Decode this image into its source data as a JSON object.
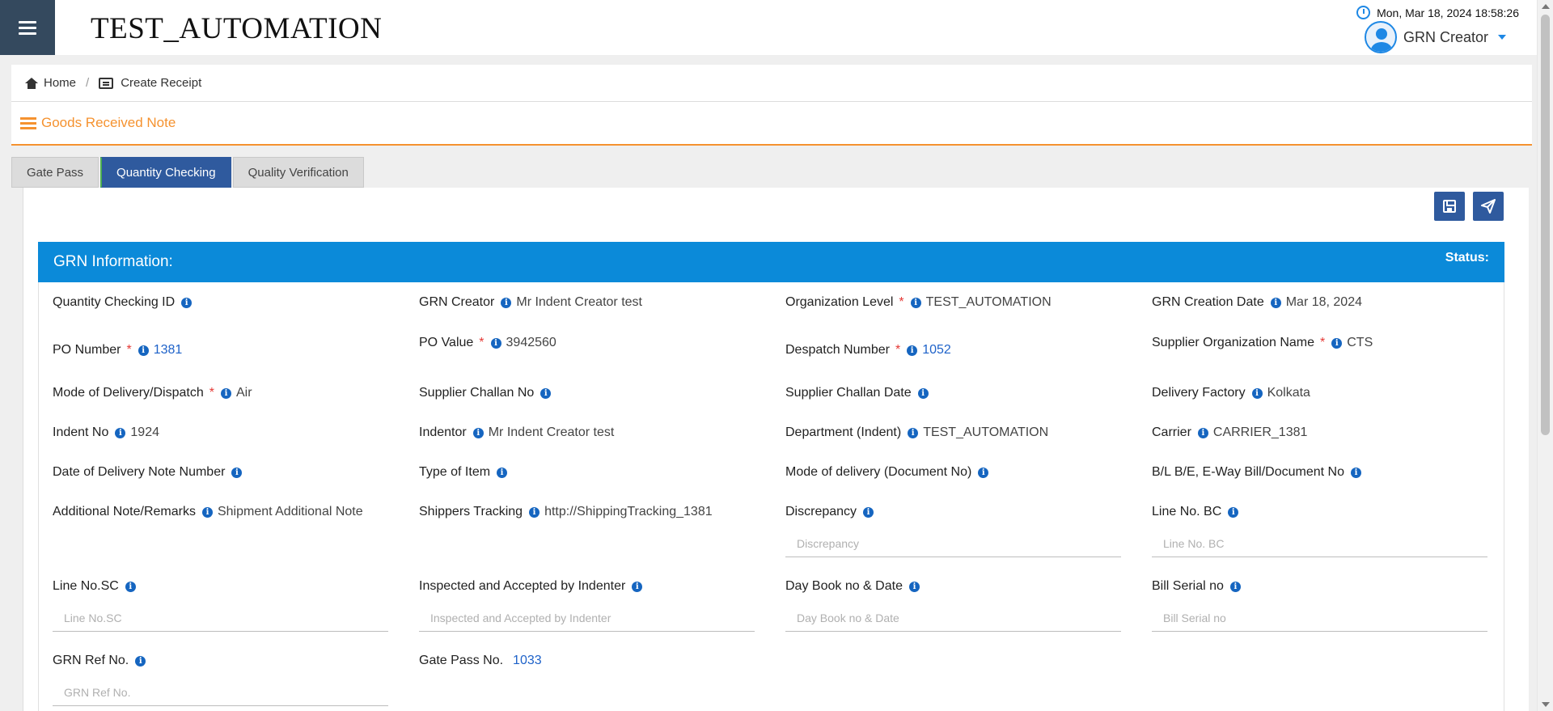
{
  "app": {
    "title": "TEST_AUTOMATION",
    "datetime": "Mon, Mar 18, 2024 18:58:26",
    "user_role": "GRN Creator"
  },
  "breadcrumb": {
    "home": "Home",
    "current": "Create Receipt"
  },
  "panel": {
    "heading": "Goods Received Note"
  },
  "tabs": [
    {
      "label": "Gate Pass"
    },
    {
      "label": "Quantity Checking"
    },
    {
      "label": "Quality Verification"
    }
  ],
  "active_tab": "Quantity Checking",
  "section": {
    "title": "GRN Information:",
    "status_label": "Status:"
  },
  "fields": {
    "quantity_checking_id": {
      "label": "Quantity Checking ID",
      "value": ""
    },
    "grn_creator": {
      "label": "GRN Creator",
      "value": "Mr Indent Creator test"
    },
    "organization_level": {
      "label": "Organization Level",
      "value": "TEST_AUTOMATION"
    },
    "grn_creation_date": {
      "label": "GRN Creation Date",
      "value": "Mar 18, 2024"
    },
    "po_number": {
      "label": "PO Number",
      "value": "1381"
    },
    "po_value": {
      "label": "PO Value",
      "value": "3942560"
    },
    "despatch_number": {
      "label": "Despatch Number",
      "value": "1052"
    },
    "supplier_org_name": {
      "label": "Supplier Organization Name",
      "value": "CTS"
    },
    "mode_of_delivery": {
      "label": "Mode of Delivery/Dispatch",
      "value": "Air"
    },
    "supplier_challan_no": {
      "label": "Supplier Challan No",
      "value": ""
    },
    "supplier_challan_date": {
      "label": "Supplier Challan Date",
      "value": ""
    },
    "delivery_factory": {
      "label": "Delivery Factory",
      "value": "Kolkata"
    },
    "indent_no": {
      "label": "Indent No",
      "value": "1924"
    },
    "indentor": {
      "label": "Indentor",
      "value": "Mr Indent Creator test"
    },
    "department": {
      "label": "Department (Indent)",
      "value": "TEST_AUTOMATION"
    },
    "carrier": {
      "label": "Carrier",
      "value": "CARRIER_1381"
    },
    "date_delivery_note": {
      "label": "Date of Delivery Note Number",
      "value": ""
    },
    "type_of_item": {
      "label": "Type of Item",
      "value": ""
    },
    "mode_delivery_doc": {
      "label": "Mode of delivery (Document No)",
      "value": ""
    },
    "bl_be_eway": {
      "label": "B/L B/E, E-Way Bill/Document No",
      "value": ""
    },
    "additional_note": {
      "label": "Additional Note/Remarks",
      "value": "Shipment Additional Note"
    },
    "shippers_tracking": {
      "label": "Shippers Tracking",
      "value": "http://ShippingTracking_1381"
    },
    "discrepancy": {
      "label": "Discrepancy",
      "placeholder": "Discrepancy"
    },
    "line_no_bc": {
      "label": "Line No. BC",
      "placeholder": "Line No. BC"
    },
    "line_no_sc": {
      "label": "Line No.SC",
      "placeholder": "Line No.SC"
    },
    "inspected_accepted": {
      "label": "Inspected and Accepted by Indenter",
      "placeholder": "Inspected and Accepted by Indenter"
    },
    "day_book": {
      "label": "Day Book no & Date",
      "placeholder": "Day Book no & Date"
    },
    "bill_serial": {
      "label": "Bill Serial no",
      "placeholder": "Bill Serial no"
    },
    "grn_ref_no": {
      "label": "GRN Ref No.",
      "placeholder": "GRN Ref No."
    },
    "gate_pass_no": {
      "label": "Gate Pass No.",
      "value": "1033"
    }
  },
  "colors": {
    "accent_blue": "#0b8ad9",
    "nav_dark": "#34495e",
    "orange": "#f5922f",
    "tab_active": "#2f5a9e",
    "link": "#1e62c9",
    "required": "#e53935"
  }
}
